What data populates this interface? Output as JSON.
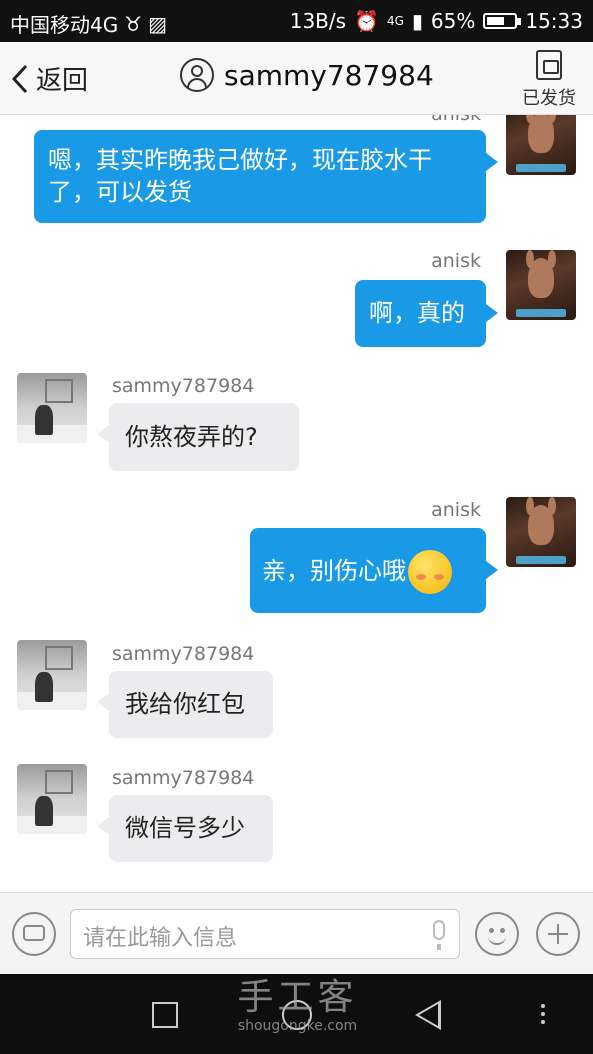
{
  "status_bar": {
    "carrier": "中国移动4G",
    "speed": "13B/s",
    "network": "4G",
    "battery": "65%",
    "battery_level": 0.65,
    "time": "15:33"
  },
  "header": {
    "back_label": "返回",
    "title": "sammy787984",
    "shipped_label": "已发货"
  },
  "messages": [
    {
      "sender": "anisk",
      "text_line1": "嗯，其实昨晚我己做好，现在胶水干",
      "text_line2": "了，可以发货"
    },
    {
      "sender": "anisk",
      "text": "啊，真的"
    },
    {
      "sender": "sammy787984",
      "text": "你熬夜弄的?"
    },
    {
      "sender": "anisk",
      "text": "亲，别伤心哦"
    },
    {
      "sender": "sammy787984",
      "text": "我给你红包"
    },
    {
      "sender": "sammy787984",
      "text": "微信号多少"
    }
  ],
  "input": {
    "placeholder": "请在此输入信息"
  },
  "watermark": {
    "line1": "手工客",
    "line2": "shougongke.com"
  }
}
